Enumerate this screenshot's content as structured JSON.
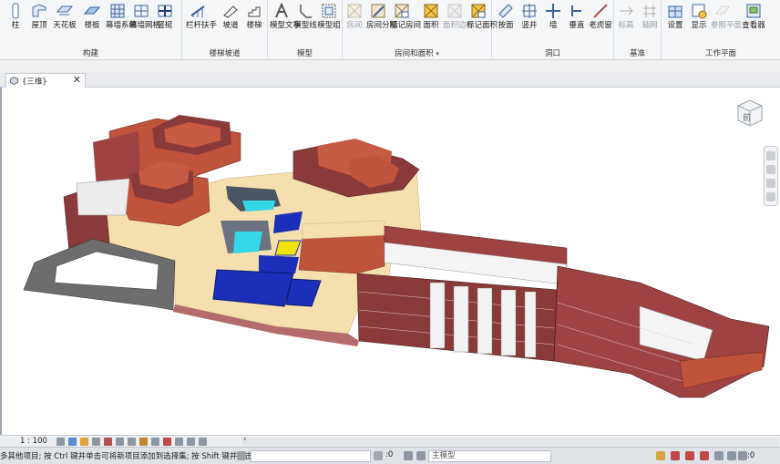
{
  "ribbon": {
    "groups": [
      {
        "label": "构建",
        "tools": [
          {
            "label": "柱",
            "icon": "column-icon"
          },
          {
            "label": "屋顶",
            "icon": "roof-icon"
          },
          {
            "label": "天花板",
            "icon": "ceiling-icon"
          },
          {
            "label": "楼板",
            "icon": "floor-icon"
          },
          {
            "label": "幕墙系统",
            "icon": "curtain-system-icon"
          },
          {
            "label": "幕墙网格",
            "icon": "curtain-grid-icon"
          },
          {
            "label": "竖梃",
            "icon": "mullion-icon"
          }
        ]
      },
      {
        "label": "楼梯坡道",
        "tools": [
          {
            "label": "栏杆扶手",
            "icon": "railing-icon"
          },
          {
            "label": "坡道",
            "icon": "ramp-icon"
          },
          {
            "label": "楼梯",
            "icon": "stair-icon"
          }
        ]
      },
      {
        "label": "模型",
        "tools": [
          {
            "label": "模型文字",
            "icon": "model-text-icon"
          },
          {
            "label": "模型线",
            "icon": "model-line-icon"
          },
          {
            "label": "模型组",
            "icon": "model-group-icon"
          }
        ]
      },
      {
        "label": "房间和面积",
        "tools": [
          {
            "label": "房间",
            "icon": "room-icon",
            "disabled": true
          },
          {
            "label": "房间分隔",
            "icon": "room-separator-icon"
          },
          {
            "label": "标记房间",
            "icon": "tag-room-icon"
          },
          {
            "label": "面积",
            "icon": "area-icon"
          },
          {
            "label": "面积边界",
            "icon": "area-boundary-icon",
            "disabled": true
          },
          {
            "label": "标记面积",
            "icon": "tag-area-icon"
          }
        ]
      },
      {
        "label": "洞口",
        "tools": [
          {
            "label": "按面",
            "icon": "by-face-icon"
          },
          {
            "label": "竖井",
            "icon": "shaft-icon"
          },
          {
            "label": "墙",
            "icon": "wall-opening-icon"
          },
          {
            "label": "垂直",
            "icon": "vertical-icon"
          },
          {
            "label": "老虎窗",
            "icon": "dormer-icon"
          }
        ]
      },
      {
        "label": "基准",
        "tools": [
          {
            "label": "标高",
            "icon": "level-icon",
            "disabled": true
          },
          {
            "label": "轴网",
            "icon": "grid-icon",
            "disabled": true
          }
        ]
      },
      {
        "label": "工作平面",
        "tools": [
          {
            "label": "设置",
            "icon": "set-icon"
          },
          {
            "label": "显示",
            "icon": "show-icon"
          },
          {
            "label": "参照平面",
            "icon": "ref-plane-icon",
            "disabled": true
          },
          {
            "label": "查看器",
            "icon": "viewer-icon"
          }
        ]
      }
    ],
    "room_area_dropdown": "▾"
  },
  "tab": {
    "label": "{三维}",
    "close": "✕"
  },
  "viewcube": {
    "face": "前"
  },
  "viewbar": {
    "scale": "1 : 100",
    "scroll_arrow": "‹"
  },
  "status": {
    "text": "多其他项目; 按 Ctrl 键并单击可将新项目添加到选择集; 按 Shift 键并单击可",
    "zero": ":0",
    "model_select": "主模型",
    "filter_count": ":0"
  },
  "colors": {
    "roof_red": "#c0533c",
    "wall_brick": "#8b3a3a",
    "floor_beige": "#f6dfae",
    "pool_blue": "#1c2fb8",
    "pool_cyan": "#33d7e8",
    "yellow_pad": "#f0e20a",
    "grey_slab": "#6d6d6d"
  }
}
